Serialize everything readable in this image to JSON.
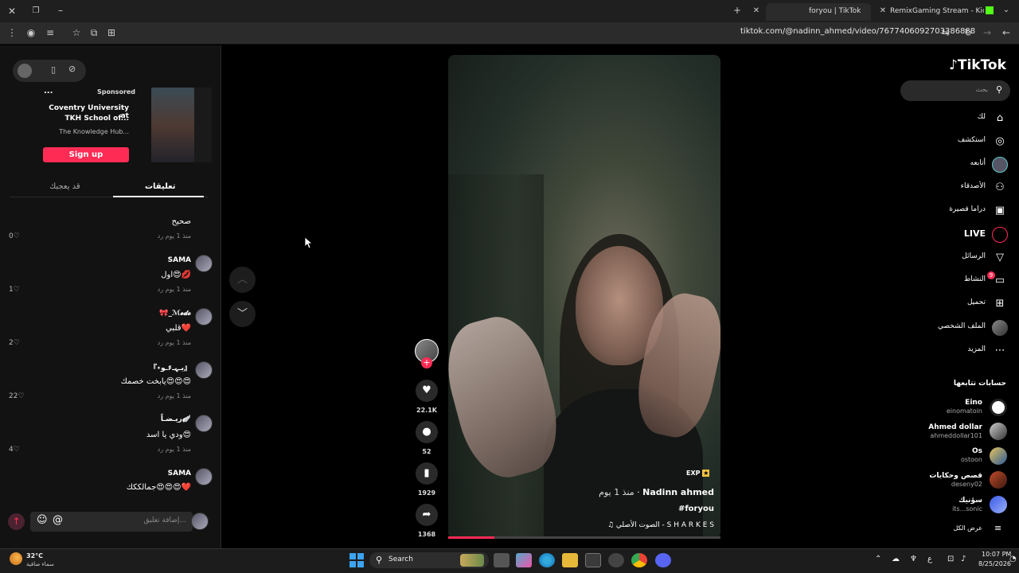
{
  "browser": {
    "tabs": [
      {
        "title": "foryou | TikTok"
      },
      {
        "title": "RemixGaming Stream - Kick De"
      }
    ],
    "url": "tiktok.com/@nadinn_ahmed/video/7677406092703386888"
  },
  "ad": {
    "sponsored": "Sponsored",
    "more": "...",
    "title_line1": "Coventry University at",
    "title_line2": "TKH School of...",
    "subtitle": "The Knowledge Hub...",
    "cta": "Sign up"
  },
  "comment_tabs": {
    "comments": "تعليقات",
    "you_may_like": "قد يعجبك"
  },
  "comments": [
    {
      "name": "",
      "text": "صحيح",
      "meta": "منذ 1 يوم   رد",
      "likes": "0"
    },
    {
      "name": "SAMA",
      "text": "اول😍💋",
      "meta": "منذ 1 يوم   رد",
      "likes": "1"
    },
    {
      "name": "🎀_ℳ𝓮𝓭𝓸",
      "text": "قلبي❤️",
      "meta": "منذ 1 يوم   رد",
      "likes": "2"
    },
    {
      "name": "『يـہـ۶ـو٭』",
      "text": "يابخت خصمك😍😍😍",
      "meta": "منذ 1 يوم   رد",
      "likes": "22"
    },
    {
      "name": "ريـضـاً🪽",
      "text": "ودي يا اسد😍",
      "meta": "منذ 1 يوم   رد",
      "likes": "4"
    },
    {
      "name": "SAMA",
      "text": "جمالككك😍😍😍❤️",
      "meta": "",
      "likes": ""
    }
  ],
  "comment_input": {
    "placeholder": "إضافة تعليق..."
  },
  "video": {
    "author": "Nadinn ahmed",
    "time": "منذ 1 يوم",
    "hashtag": "#foryou",
    "sound": "♫ الصوت الأصلي - S H A R K E S",
    "badge": "EXP",
    "progress": 0.17
  },
  "actions": {
    "likes": "22.1K",
    "comments": "52",
    "saves": "1929",
    "shares": "1368"
  },
  "sidebar": {
    "logo": "TikTok",
    "search_placeholder": "بحث",
    "nav": [
      {
        "label": "لك",
        "icon": "home-icon"
      },
      {
        "label": "استكشف",
        "icon": "compass-icon"
      },
      {
        "label": "أتابعه",
        "icon": "following-avatar-icon"
      },
      {
        "label": "الأصدقاء",
        "icon": "friends-icon"
      },
      {
        "label": "دراما قصيرة",
        "icon": "film-icon"
      },
      {
        "label": "LIVE",
        "icon": "live-icon"
      },
      {
        "label": "الرسائل",
        "icon": "send-icon"
      },
      {
        "label": "النشاط",
        "icon": "activity-icon",
        "badge": "9"
      },
      {
        "label": "تحميل",
        "icon": "upload-icon"
      },
      {
        "label": "الملف الشخصي",
        "icon": "profile-icon"
      },
      {
        "label": "المزيد",
        "icon": "more-icon"
      }
    ],
    "following_title": "حسابات تتابعها",
    "following": [
      {
        "name": "Eino",
        "handle": "einomatoin"
      },
      {
        "name": "Ahmed dollar",
        "handle": "ahmeddollar101"
      },
      {
        "name": "Os",
        "handle": "ostoon"
      },
      {
        "name": "قصص وحكايات",
        "handle": "deseny02"
      },
      {
        "name": "سؤنيك",
        "handle": "its...sonic"
      }
    ],
    "see_all": "عرض الكل"
  },
  "taskbar": {
    "weather_temp": "32°C",
    "weather_desc": "سماء صافية",
    "search": "Search",
    "time": "10:07 PM",
    "date": "8/25/2026"
  },
  "colors": {
    "accent": "#fe2c55",
    "bg": "#000000",
    "panel": "#121212"
  }
}
